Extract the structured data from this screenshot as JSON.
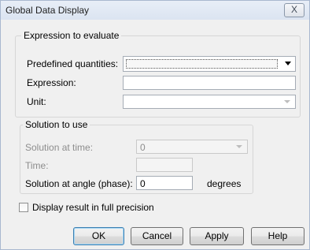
{
  "window": {
    "title": "Global Data Display",
    "close_label": "X"
  },
  "expression_group": {
    "label": "Expression to evaluate",
    "predefined_label": "Predefined quantities:",
    "predefined_value": "",
    "expression_label": "Expression:",
    "expression_value": "",
    "unit_label": "Unit:",
    "unit_value": ""
  },
  "solution_group": {
    "label": "Solution to use",
    "time_solution_label": "Solution at time:",
    "time_solution_value": "0",
    "time_label": "Time:",
    "time_value": "",
    "angle_label": "Solution at angle (phase):",
    "angle_value": "0",
    "angle_unit": "degrees"
  },
  "full_precision": {
    "label": "Display result in full precision",
    "checked": false
  },
  "buttons": {
    "ok": "OK",
    "cancel": "Cancel",
    "apply": "Apply",
    "help": "Help"
  }
}
